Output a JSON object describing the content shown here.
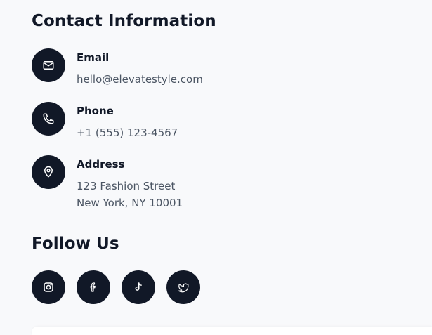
{
  "contact": {
    "title": "Contact Information",
    "items": [
      {
        "label": "Email",
        "value_line1": "hello@elevatestyle.com",
        "icon": "mail-icon"
      },
      {
        "label": "Phone",
        "value_line1": "+1 (555) 123-4567",
        "icon": "phone-icon"
      },
      {
        "label": "Address",
        "value_line1": "123 Fashion Street",
        "value_line2": "New York, NY 10001",
        "icon": "map-pin-icon"
      }
    ]
  },
  "follow": {
    "title": "Follow Us",
    "socials": [
      {
        "name": "instagram",
        "icon": "instagram-icon"
      },
      {
        "name": "facebook",
        "icon": "facebook-icon"
      },
      {
        "name": "tiktok",
        "icon": "tiktok-icon"
      },
      {
        "name": "twitter",
        "icon": "twitter-icon"
      }
    ]
  },
  "colors": {
    "background": "#f8f9fb",
    "icon_bg": "#111827",
    "heading": "#111827",
    "value_text": "#4b5563",
    "card": "#ffffff"
  }
}
